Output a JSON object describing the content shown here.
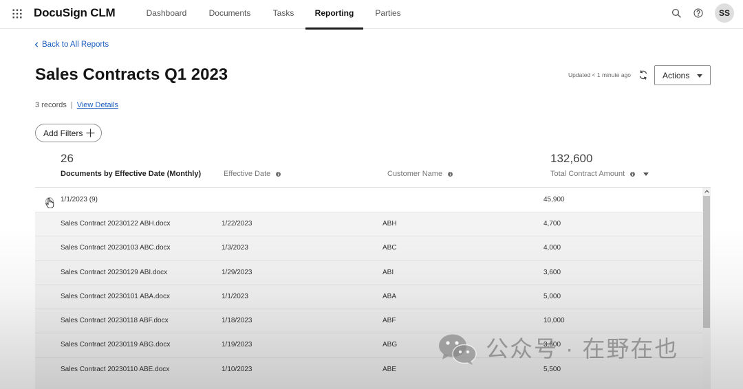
{
  "app": {
    "name": "DocuSign CLM"
  },
  "nav": {
    "items": [
      {
        "label": "Dashboard",
        "active": false
      },
      {
        "label": "Documents",
        "active": false
      },
      {
        "label": "Tasks",
        "active": false
      },
      {
        "label": "Reporting",
        "active": true
      },
      {
        "label": "Parties",
        "active": false
      }
    ]
  },
  "user": {
    "initials": "SS"
  },
  "breadcrumb": {
    "back_label": "Back to All Reports"
  },
  "report": {
    "title": "Sales Contracts Q1 2023",
    "updated_text": "Updated < 1 minute ago",
    "actions_label": "Actions",
    "record_count": "3 records",
    "separator": "|",
    "view_details_label": "View Details",
    "add_filters_label": "Add Filters"
  },
  "summary": {
    "documents_count": "26",
    "total_amount": "132,600"
  },
  "columns": [
    {
      "label": "Documents by Effective Date (Monthly)",
      "info": false,
      "dropdown": false
    },
    {
      "label": "Effective Date",
      "info": true,
      "dropdown": false
    },
    {
      "label": "Customer Name",
      "info": true,
      "dropdown": false
    },
    {
      "label": "Total Contract Amount",
      "info": true,
      "dropdown": true
    }
  ],
  "groups": [
    {
      "label": "1/1/2023 (9)",
      "amount": "45,900",
      "expanded": true,
      "rows": [
        {
          "document": "Sales Contract 20230122 ABH.docx",
          "effective_date": "1/22/2023",
          "customer": "ABH",
          "amount": "4,700"
        },
        {
          "document": "Sales Contract 20230103 ABC.docx",
          "effective_date": "1/3/2023",
          "customer": "ABC",
          "amount": "4,000"
        },
        {
          "document": "Sales Contract 20230129 ABI.docx",
          "effective_date": "1/29/2023",
          "customer": "ABI",
          "amount": "3,600"
        },
        {
          "document": "Sales Contract 20230101 ABA.docx",
          "effective_date": "1/1/2023",
          "customer": "ABA",
          "amount": "5,000"
        },
        {
          "document": "Sales Contract 20230118 ABF.docx",
          "effective_date": "1/18/2023",
          "customer": "ABF",
          "amount": "10,000"
        },
        {
          "document": "Sales Contract 20230119 ABG.docx",
          "effective_date": "1/19/2023",
          "customer": "ABG",
          "amount": "3,600"
        },
        {
          "document": "Sales Contract 20230110 ABE.docx",
          "effective_date": "1/10/2023",
          "customer": "ABE",
          "amount": "5,500"
        }
      ]
    }
  ],
  "watermark": {
    "text": "公众号 · 在野在也",
    "icon": "wechat-icon"
  },
  "icons": {
    "apps": "apps-grid-icon",
    "search": "search-icon",
    "help": "help-icon",
    "back": "chevron-left-icon",
    "refresh": "refresh-icon",
    "actions_caret": "caret-down-icon",
    "add_filters": "plus-icon",
    "column_info": "info-icon",
    "column_menu": "sort-caret-icon",
    "group_toggle": "hand-cursor-icon",
    "scroll_up": "chevron-up-icon"
  },
  "colors": {
    "link": "#1d5fc0",
    "active_tab_underline": "#1b1b1b",
    "avatar_bg": "#dedede",
    "row_bg": "#f3f3f3"
  }
}
